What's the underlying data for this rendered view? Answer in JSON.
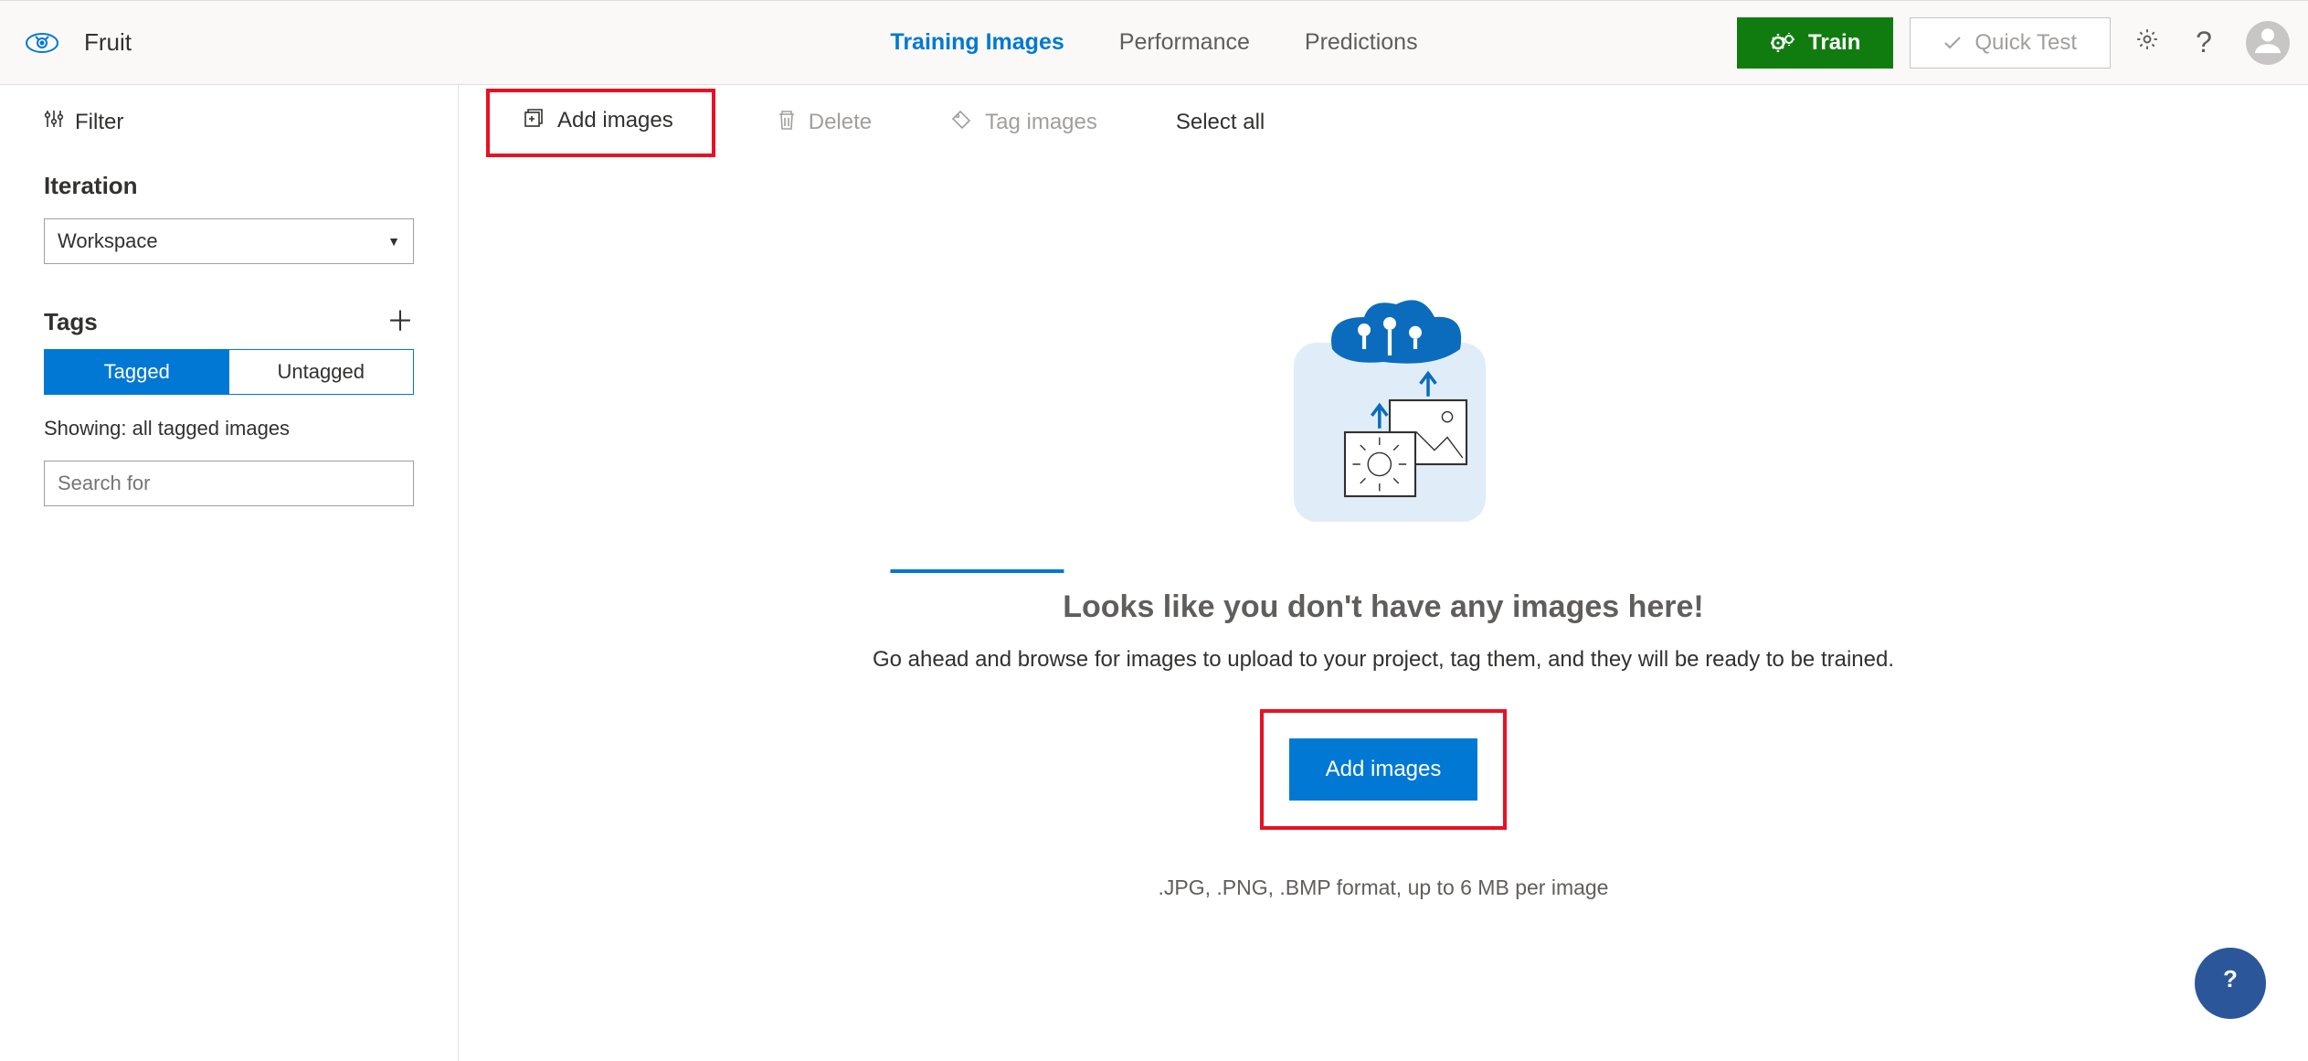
{
  "header": {
    "project_name": "Fruit",
    "tabs": [
      "Training Images",
      "Performance",
      "Predictions"
    ],
    "active_tab": 0,
    "train_label": "Train",
    "quicktest_label": "Quick Test"
  },
  "sidebar": {
    "filter_label": "Filter",
    "iteration_label": "Iteration",
    "iteration_value": "Workspace",
    "tags_label": "Tags",
    "seg": {
      "tagged": "Tagged",
      "untagged": "Untagged"
    },
    "showing_text": "Showing: all tagged images",
    "search_placeholder": "Search for"
  },
  "toolbar": {
    "add_images": "Add images",
    "delete": "Delete",
    "tag_images": "Tag images",
    "select_all": "Select all"
  },
  "empty": {
    "heading": "Looks like you don't have any images here!",
    "subtext": "Go ahead and browse for images to upload to your project, tag them, and they will be ready to be trained.",
    "add_button": "Add images",
    "formats": ".JPG, .PNG, .BMP format, up to 6 MB per image"
  }
}
